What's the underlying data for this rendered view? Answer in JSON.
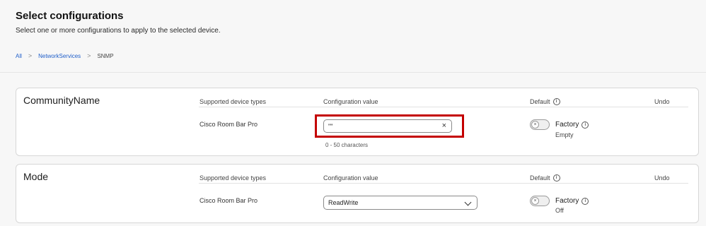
{
  "page": {
    "title": "Select configurations",
    "subtitle": "Select one or more configurations to apply to the selected device."
  },
  "breadcrumb": {
    "items": [
      "All",
      "NetworkServices",
      "SNMP"
    ],
    "separator": ">"
  },
  "columns": {
    "device_types": "Supported device types",
    "config_value": "Configuration value",
    "default": "Default",
    "undo": "Undo"
  },
  "cards": [
    {
      "name": "CommunityName",
      "device": "Cisco Room Bar Pro",
      "value": "\"\"",
      "hint": "0 - 50 characters",
      "default_label": "Factory",
      "default_value": "Empty",
      "toggle_glyph": "×",
      "clear_glyph": "×"
    },
    {
      "name": "Mode",
      "device": "Cisco Room Bar Pro",
      "value": "ReadWrite",
      "default_label": "Factory",
      "default_value": "Off",
      "toggle_glyph": "×"
    }
  ],
  "icons": {
    "info": "i"
  },
  "colors": {
    "link": "#1f5ec9",
    "highlight": "#c40000"
  }
}
